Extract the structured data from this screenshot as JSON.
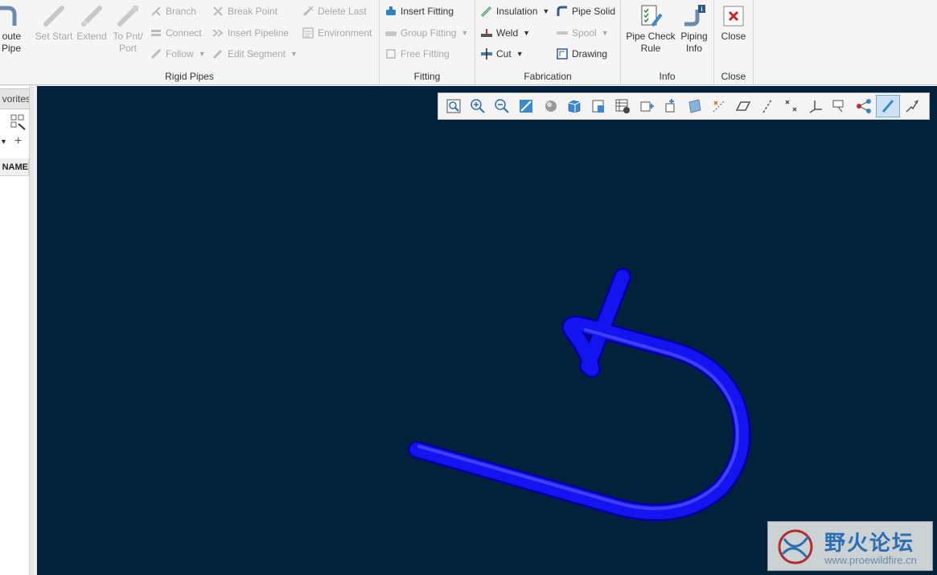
{
  "ribbon": {
    "rigid_pipes": {
      "label": "Rigid Pipes",
      "route_pipe": "oute\nPipe",
      "set_start": "Set Start",
      "extend": "Extend",
      "to_pnt_port": "To Pnt/\nPort",
      "branch": "Branch",
      "connect": "Connect",
      "follow": "Follow",
      "break_point": "Break Point",
      "insert_pipeline": "Insert Pipeline",
      "edit_segment": "Edit Segment",
      "delete_last": "Delete Last",
      "environment": "Environment"
    },
    "fitting": {
      "label": "Fitting",
      "insert_fitting": "Insert Fitting",
      "group_fitting": "Group Fitting",
      "free_fitting": "Free Fitting"
    },
    "fabrication": {
      "label": "Fabrication",
      "insulation": "Insulation",
      "weld": "Weld",
      "cut": "Cut",
      "pipe_solid": "Pipe Solid",
      "spool": "Spool",
      "drawing": "Drawing"
    },
    "info": {
      "label": "Info",
      "pipe_check_rule": "Pipe Check\nRule",
      "piping_info": "Piping\nInfo"
    },
    "close": {
      "label": "Close",
      "close_button": "Close"
    }
  },
  "left_panel": {
    "favorites_tab": "vorites",
    "column_header": "NAME"
  },
  "watermark": {
    "chinese": "野火论坛",
    "url": "www.proewildfire.cn"
  },
  "colors": {
    "viewport_bg": "#01223a",
    "pipe": "#1212e8",
    "accent": "#1f6fbf"
  }
}
